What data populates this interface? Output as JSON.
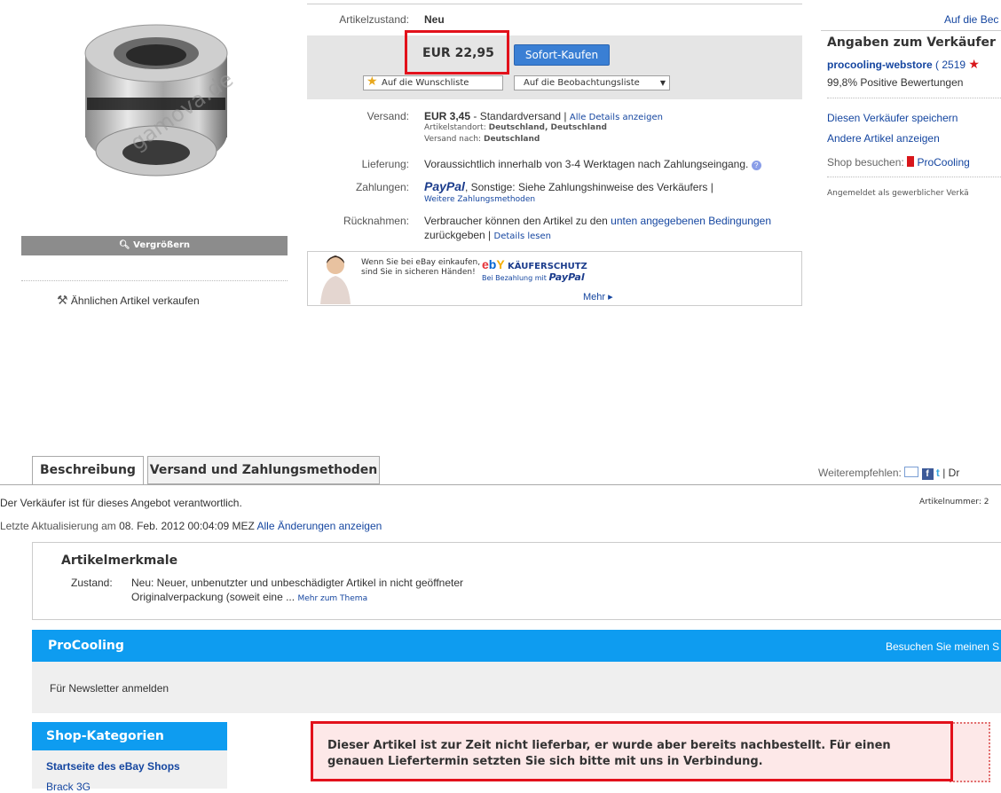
{
  "product": {
    "image_alt": "Fitting",
    "watermark": "gamova.de",
    "zoom_label": "Vergrößern",
    "sell_similar": "Ähnlichen Artikel verkaufen"
  },
  "listing": {
    "condition_label": "Artikelzustand:",
    "condition_value": "Neu",
    "price": "EUR 22,95",
    "buy_now": "Sofort-Kaufen",
    "wishlist": "Auf die Wunschliste",
    "watchlist": "Auf die Beobachtungsliste",
    "shipping_label": "Versand:",
    "shipping_cost": "EUR 3,45",
    "shipping_type": " - Standardversand",
    "shipping_details": "Alle Details anzeigen",
    "location_label": "Artikelstandort:",
    "location_value": "Deutschland, Deutschland",
    "ship_to_label": "Versand nach:",
    "ship_to_value": "Deutschland",
    "delivery_label": "Lieferung:",
    "delivery_value": "Voraussichtlich innerhalb von 3-4 Werktagen nach Zahlungseingang.",
    "payment_label": "Zahlungen:",
    "payment_paypal": "PayPal",
    "payment_other": ", Sonstige: Siehe Zahlungshinweise des Verkäufers |",
    "payment_more": "Weitere Zahlungsmethoden",
    "returns_label": "Rücknahmen:",
    "returns_text1": "Verbraucher können den Artikel zu den",
    "returns_link": "unten angegebenen Bedingungen",
    "returns_text2": "zurückgeben |",
    "returns_details": "Details lesen",
    "protect_line1": "Wenn Sie bei eBay einkaufen,",
    "protect_line2": "sind Sie in sicheren Händen!",
    "protect_title": "KÄUFERSCHUTZ",
    "protect_sub": "Bei Bezahlung mit",
    "protect_paypal": "PayPal",
    "protect_more": "Mehr ▸"
  },
  "seller": {
    "top_link": "Auf die Bec",
    "title": "Angaben zum Verkäufer",
    "name": "procooling-webstore",
    "score": "( 2519",
    "positive": "99,8% Positive Bewertungen",
    "save": "Diesen Verkäufer speichern",
    "other": "Andere Artikel anzeigen",
    "shop_label": "Shop besuchen:",
    "shop_name": "ProCooling",
    "registered": "Angemeldet als gewerblicher Verkä"
  },
  "tabs": {
    "description": "Beschreibung",
    "shipping": "Versand und Zahlungsmethoden",
    "recommend": "Weiterempfehlen:",
    "print_prefix": "| Dr"
  },
  "info": {
    "responsible": "Der Verkäufer ist für dieses Angebot verantwortlich.",
    "item_number": "Artikelnummer: 2",
    "updated_prefix": "Letzte Aktualisierung am ",
    "updated_date": "08. Feb. 2012 00:04:09 MEZ",
    "changes_link": "Alle Änderungen anzeigen"
  },
  "features": {
    "title": "Artikelmerkmale",
    "condition_label": "Zustand:",
    "condition_line1": "Neu: Neuer, unbenutzter und unbeschädigter Artikel in nicht geöffneter",
    "condition_line2": "Originalverpackung (soweit eine ...",
    "more": "Mehr zum Thema"
  },
  "store": {
    "name": "ProCooling",
    "visit": "Besuchen Sie meinen S",
    "newsletter": "Für Newsletter anmelden",
    "categories_title": "Shop-Kategorien",
    "home": "Startseite des eBay Shops",
    "next_item": "Brack 3G"
  },
  "notice": {
    "line1": "Dieser Artikel ist zur Zeit nicht lieferbar, er wurde aber bereits nachbestellt. Für einen",
    "line2": "genauen Liefertermin setzten Sie sich bitte mit uns in Verbindung."
  }
}
